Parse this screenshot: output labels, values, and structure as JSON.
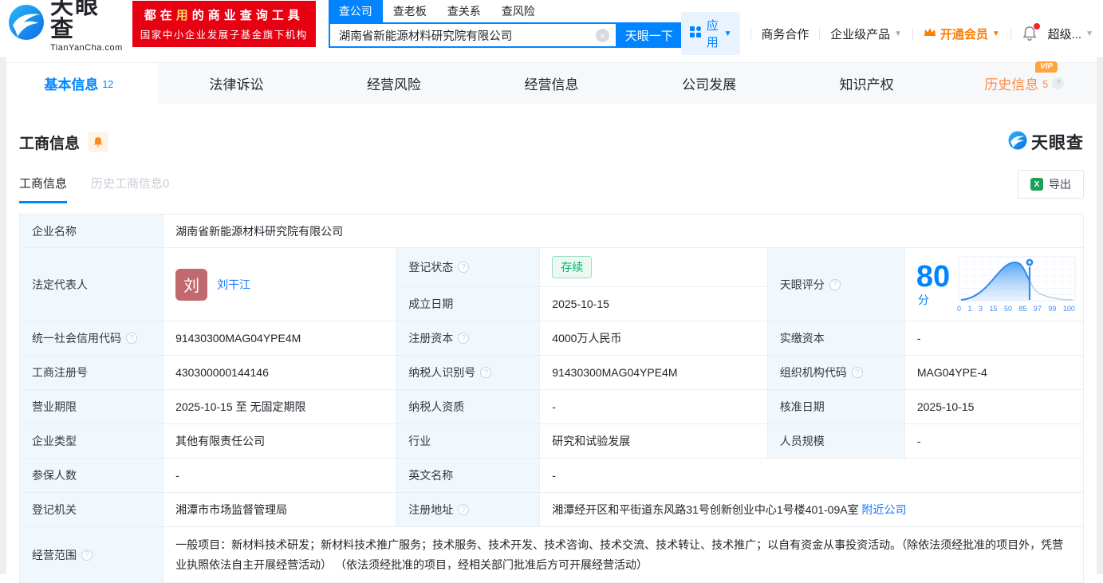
{
  "brand": {
    "name": "天眼查",
    "domain": "TianYanCha.com",
    "slogan_line1_pre": "都在",
    "slogan_line1_highlight": "用",
    "slogan_line1_post": "的商业查询工具",
    "slogan_line2": "国家中小企业发展子基金旗下机构"
  },
  "search": {
    "tabs": [
      "查公司",
      "查老板",
      "查关系",
      "查风险"
    ],
    "value": "湖南省新能源材料研究院有限公司",
    "button": "天眼一下"
  },
  "nav": {
    "apps": "应用",
    "cooperation": "商务合作",
    "enterprise": "企业级产品",
    "vip": "开通会员",
    "super": "超级..."
  },
  "page_tabs": [
    {
      "label": "基本信息",
      "count": "12"
    },
    {
      "label": "法律诉讼"
    },
    {
      "label": "经营风险"
    },
    {
      "label": "经营信息"
    },
    {
      "label": "公司发展"
    },
    {
      "label": "知识产权"
    },
    {
      "label": "历史信息",
      "count": "5",
      "badge": "VIP"
    }
  ],
  "section": {
    "title": "工商信息",
    "logo": "天眼查",
    "subtabs": [
      "工商信息",
      "历史工商信息0"
    ],
    "export_label": "导出"
  },
  "fields": {
    "company_name": {
      "label": "企业名称",
      "value": "湖南省新能源材料研究院有限公司"
    },
    "legal_rep": {
      "label": "法定代表人",
      "avatar": "刘",
      "value": "刘干江"
    },
    "reg_status": {
      "label": "登记状态",
      "value": "存续"
    },
    "establish_date": {
      "label": "成立日期",
      "value": "2025-10-15"
    },
    "score": {
      "label": "天眼评分"
    },
    "credit_code": {
      "label": "统一社会信用代码",
      "value": "91430300MAG04YPE4M"
    },
    "reg_capital": {
      "label": "注册资本",
      "value": "4000万人民币"
    },
    "paid_capital": {
      "label": "实缴资本",
      "value": "-"
    },
    "reg_number": {
      "label": "工商注册号",
      "value": "430300000144146"
    },
    "taxpayer_id": {
      "label": "纳税人识别号",
      "value": "91430300MAG04YPE4M"
    },
    "org_code": {
      "label": "组织机构代码",
      "value": "MAG04YPE-4"
    },
    "business_term": {
      "label": "营业期限",
      "value": "2025-10-15 至 无固定期限"
    },
    "taxpayer_quality": {
      "label": "纳税人资质",
      "value": "-"
    },
    "approval_date": {
      "label": "核准日期",
      "value": "2025-10-15"
    },
    "company_type": {
      "label": "企业类型",
      "value": "其他有限责任公司"
    },
    "industry": {
      "label": "行业",
      "value": "研究和试验发展"
    },
    "staff_size": {
      "label": "人员规模",
      "value": "-"
    },
    "insured_count": {
      "label": "参保人数",
      "value": "-"
    },
    "english_name": {
      "label": "英文名称",
      "value": "-"
    },
    "reg_authority": {
      "label": "登记机关",
      "value": "湘潭市市场监督管理局"
    },
    "reg_address": {
      "label": "注册地址",
      "value": "湘潭经开区和平街道东风路31号创新创业中心1号楼401-09A室",
      "link": "附近公司"
    },
    "business_scope": {
      "label": "经营范围",
      "value": "一般项目：新材料技术研发；新材料技术推广服务；技术服务、技术开发、技术咨询、技术交流、技术转让、技术推广；以自有资金从事投资活动。（除依法须经批准的项目外，凭营业执照依法自主开展经营活动） （依法须经批准的项目，经相关部门批准后方可开展经营活动）"
    }
  },
  "score": {
    "value": "80",
    "unit": "分",
    "axis": [
      "0",
      "1",
      "3",
      "15",
      "50",
      "85",
      "97",
      "99",
      "100"
    ]
  },
  "colors": {
    "brand_blue": "#0084ff",
    "slogan_red": "#e60012",
    "vip_orange": "#ff7d00",
    "history_orange": "#ff8b4a",
    "status_green": "#00b365"
  }
}
